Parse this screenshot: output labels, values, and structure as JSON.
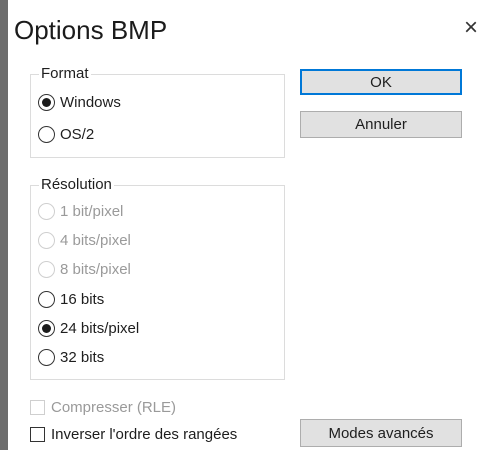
{
  "window": {
    "title": "Options BMP",
    "close_glyph": "×"
  },
  "format": {
    "legend": "Format",
    "options": [
      {
        "label": "Windows",
        "checked": true,
        "enabled": true
      },
      {
        "label": "OS/2",
        "checked": false,
        "enabled": true
      }
    ]
  },
  "resolution": {
    "legend": "Résolution",
    "options": [
      {
        "label": "1 bit/pixel",
        "checked": false,
        "enabled": false
      },
      {
        "label": "4 bits/pixel",
        "checked": false,
        "enabled": false
      },
      {
        "label": "8 bits/pixel",
        "checked": false,
        "enabled": false
      },
      {
        "label": "16 bits",
        "checked": false,
        "enabled": true
      },
      {
        "label": "24 bits/pixel",
        "checked": true,
        "enabled": true
      },
      {
        "label": "32 bits",
        "checked": false,
        "enabled": true
      }
    ]
  },
  "checkboxes": {
    "compress": {
      "label": "Compresser (RLE)",
      "checked": false,
      "enabled": false
    },
    "invert": {
      "label": "Inverser l'ordre des rangées",
      "checked": false,
      "enabled": true
    }
  },
  "buttons": {
    "ok": "OK",
    "cancel": "Annuler",
    "advanced": "Modes avancés"
  },
  "colors": {
    "accent": "#0078d7",
    "disabled_text": "#9a9a9a"
  }
}
